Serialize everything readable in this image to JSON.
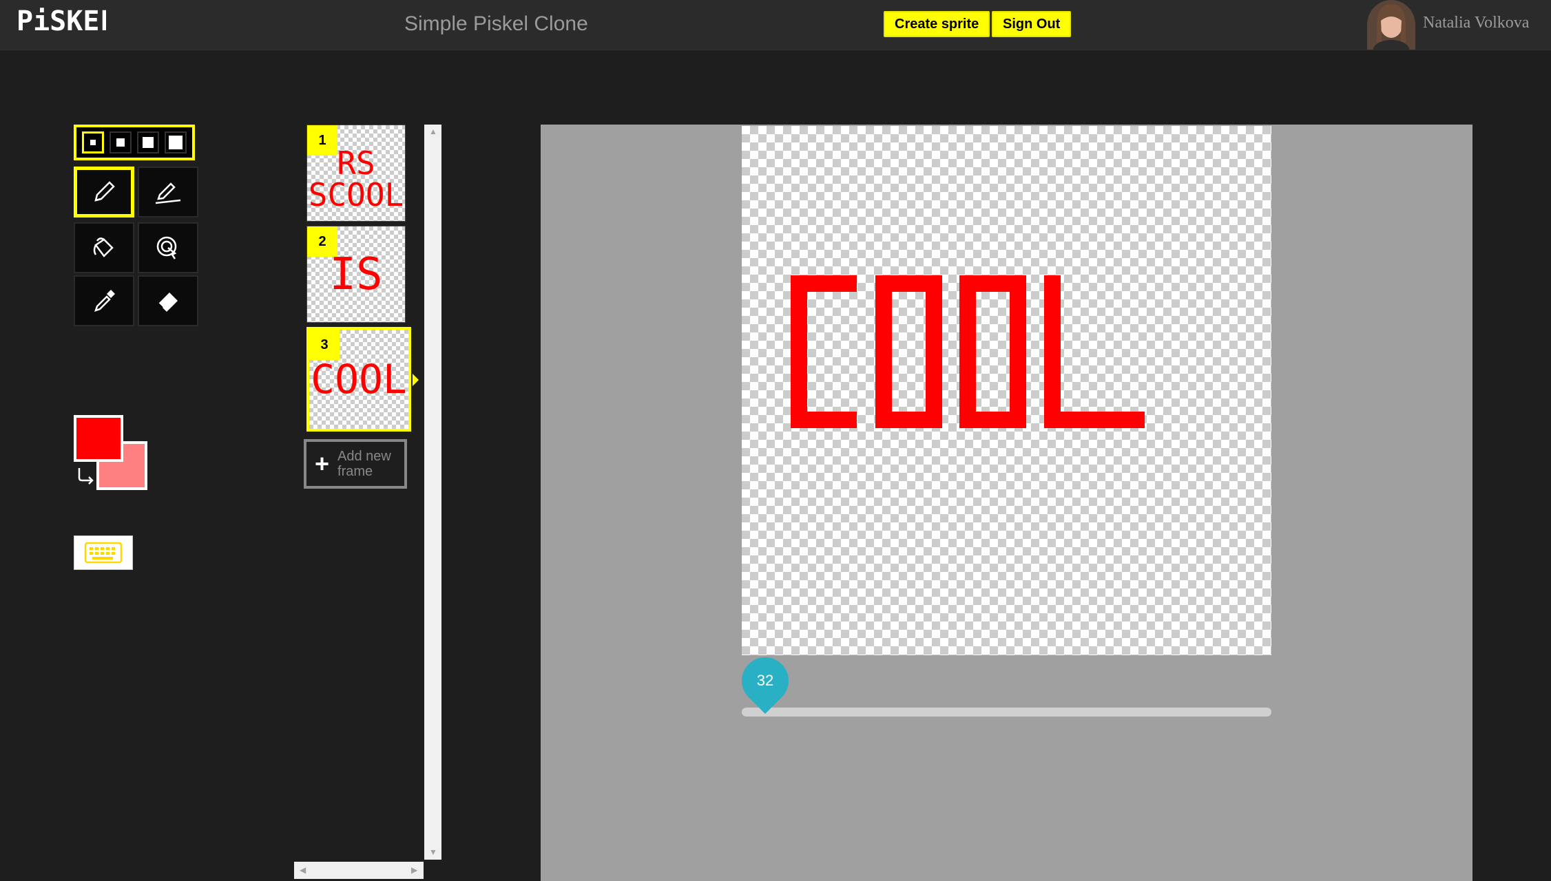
{
  "header": {
    "app_title": "Simple Piskel Clone",
    "create_sprite_label": "Create sprite",
    "sign_out_label": "Sign Out",
    "user_name": "Natalia Volkova"
  },
  "tools": {
    "pen_sizes": [
      1,
      2,
      3,
      4
    ],
    "selected_pen_size": 1,
    "items": [
      "pen-icon",
      "stroke-icon",
      "paint-bucket-icon",
      "same-color-fill-icon",
      "color-picker-icon",
      "eraser-icon"
    ],
    "selected_tool": "pen-icon"
  },
  "colors": {
    "primary": "#ff0000",
    "secondary": "#ff8080",
    "accent": "#ffff00"
  },
  "frames": {
    "items": [
      {
        "number": "1",
        "preview_text": "RS SCOOL"
      },
      {
        "number": "2",
        "preview_text": "IS"
      },
      {
        "number": "3",
        "preview_text": "COOL"
      }
    ],
    "selected": 3,
    "add_label": "Add new frame"
  },
  "canvas": {
    "drawn_text": "COOL",
    "size_value": "32"
  }
}
